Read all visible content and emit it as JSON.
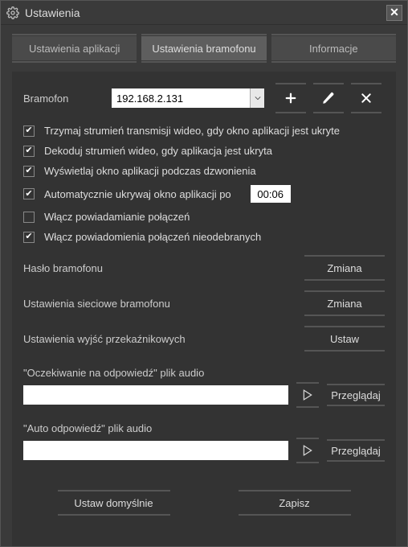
{
  "window": {
    "title": "Ustawienia"
  },
  "tabs": {
    "items": [
      {
        "label": "Ustawienia aplikacji",
        "active": false
      },
      {
        "label": "Ustawienia bramofonu",
        "active": true
      },
      {
        "label": "Informacje",
        "active": false
      }
    ]
  },
  "bramofon": {
    "label": "Bramofon",
    "value": "192.168.2.131"
  },
  "checks": [
    {
      "label": "Trzymaj strumień transmisji wideo, gdy okno aplikacji jest ukryte",
      "checked": true
    },
    {
      "label": "Dekoduj strumień wideo, gdy aplikacja jest ukryta",
      "checked": true
    },
    {
      "label": "Wyświetlaj okno aplikacji podczas dzwonienia",
      "checked": true
    },
    {
      "label": "Automatycznie ukrywaj okno aplikacji po",
      "checked": true,
      "time": "00:06"
    },
    {
      "label": "Włącz powiadamianie połączeń",
      "checked": false
    },
    {
      "label": "Włącz powiadomienia połączeń nieodebranych",
      "checked": true
    }
  ],
  "settings": {
    "password": {
      "label": "Hasło bramofonu",
      "button": "Zmiana"
    },
    "network": {
      "label": "Ustawienia sieciowe bramofonu",
      "button": "Zmiana"
    },
    "relay": {
      "label": "Ustawienia wyjść przekaźnikowych",
      "button": "Ustaw"
    }
  },
  "audio": {
    "waiting": {
      "label": "\"Oczekiwanie na odpowiedź\" plik audio",
      "path": "",
      "browse": "Przeglądaj"
    },
    "auto": {
      "label": "\"Auto odpowiedź\" plik audio",
      "path": "",
      "browse": "Przeglądaj"
    }
  },
  "footer": {
    "defaults": "Ustaw domyślnie",
    "save": "Zapisz"
  }
}
